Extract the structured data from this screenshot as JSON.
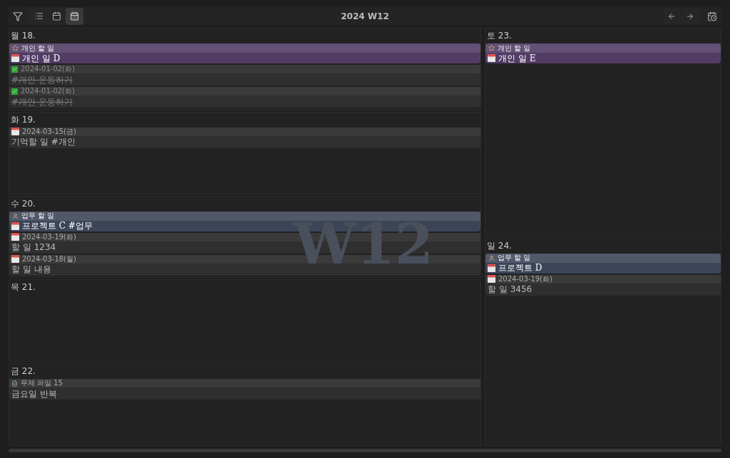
{
  "toolbar": {
    "title": "2024 W12",
    "views": [
      {
        "selected": false
      },
      {
        "selected": false
      },
      {
        "selected": true
      }
    ]
  },
  "week_watermark": "W12",
  "columns": [
    {
      "days": [
        {
          "label": "월 18.",
          "items": [
            {
              "kind": "personal",
              "color": "#523c66",
              "header": "개인 할 일",
              "title": "개인 일 D"
            },
            {
              "kind": "task",
              "done": true,
              "date": "2024-01-02(화)",
              "title": "#개인 운동하기"
            },
            {
              "kind": "task",
              "done": true,
              "date": "2024-01-02(화)",
              "title": "#개인 운동하기"
            }
          ]
        },
        {
          "label": "화 19.",
          "items": [
            {
              "kind": "task",
              "done": false,
              "date": "2024-03-15(금)",
              "title": "기억할 일 #개인"
            }
          ]
        },
        {
          "label": "수 20.",
          "items": [
            {
              "kind": "work",
              "color": "#3c4558",
              "header": "업무 할 일",
              "title": "프로젝트 C #업무"
            },
            {
              "kind": "task",
              "done": false,
              "date": "2024-03-19(화)",
              "title": "할 일 1234"
            },
            {
              "kind": "task",
              "done": false,
              "date": "2024-03-18(월)",
              "title": "할 일 내용"
            }
          ]
        },
        {
          "label": "목 21."
        },
        {
          "label": "금 22.",
          "items": [
            {
              "kind": "note",
              "date": "무제 파일 15",
              "title": "금요일 반복"
            }
          ]
        }
      ]
    },
    {
      "days": [
        {
          "label": "토 23.",
          "items": [
            {
              "kind": "personal",
              "color": "#523c66",
              "header": "개인 할 일",
              "title": "개인 일 E"
            }
          ]
        },
        {
          "label": "일 24.",
          "items": [
            {
              "kind": "work",
              "color": "#3c4558",
              "header": "업무 할 일",
              "title": "프로젝트 D"
            },
            {
              "kind": "task",
              "done": false,
              "date": "2024-03-19(화)",
              "title": "할 일 3456"
            }
          ]
        }
      ]
    }
  ]
}
